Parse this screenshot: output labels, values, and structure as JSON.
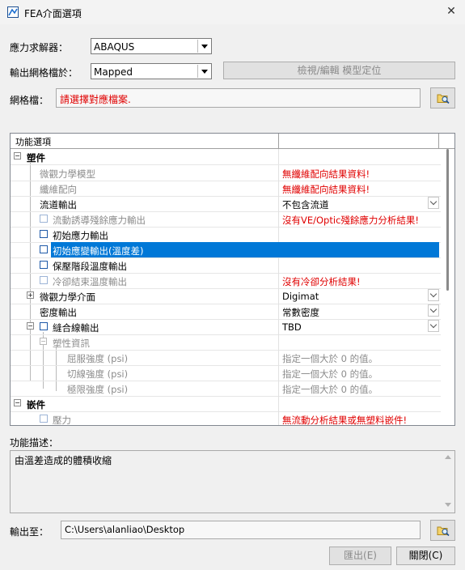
{
  "window": {
    "title": "FEA介面選項",
    "close_glyph": "✕"
  },
  "solver": {
    "label": "應力求解器：",
    "value": "ABAQUS"
  },
  "mesh_output": {
    "label": "輸出網格檔於：",
    "value": "Mapped",
    "button_label": "檢視/編輯 模型定位"
  },
  "mesh_file": {
    "label": "網格檔：",
    "value": "請選擇對應檔案."
  },
  "grid": {
    "header_col1": "功能選項",
    "header_col2": "",
    "rows": [
      {
        "name": "塑件",
        "value": ""
      },
      {
        "name": "微觀力學模型",
        "value": "無纖維配向結果資料!"
      },
      {
        "name": "纖維配向",
        "value": "無纖維配向結果資料!"
      },
      {
        "name": "流道輸出",
        "value": "不包含流道"
      },
      {
        "name": "流動誘導殘餘應力輸出",
        "value": "沒有VE/Optic殘餘應力分析結果!"
      },
      {
        "name": "初始應力輸出",
        "value": ""
      },
      {
        "name": "初始應變輸出(溫度差)",
        "value": ""
      },
      {
        "name": "保壓階段溫度輸出",
        "value": ""
      },
      {
        "name": "冷卻結束溫度輸出",
        "value": "沒有冷卻分析結果!"
      },
      {
        "name": "微觀力學介面",
        "value": "Digimat"
      },
      {
        "name": "密度輸出",
        "value": "常數密度"
      },
      {
        "name": "縫合線輸出",
        "value": "TBD"
      },
      {
        "name": "塑性資訊",
        "value": ""
      },
      {
        "name": "屈服強度 (psi)",
        "value": "指定一個大於 0 的值。"
      },
      {
        "name": "切線強度 (psi)",
        "value": "指定一個大於 0 的值。"
      },
      {
        "name": "極限強度 (psi)",
        "value": "指定一個大於 0 的值。"
      },
      {
        "name": "嵌件",
        "value": ""
      },
      {
        "name": "壓力",
        "value": "無流動分析結果或無塑料嵌件!"
      }
    ]
  },
  "description": {
    "label": "功能描述：",
    "text": "由溫差造成的體積收縮"
  },
  "output_to": {
    "label": "輸出至：",
    "value": "C:\\Users\\alanliao\\Desktop"
  },
  "buttons": {
    "export": "匯出(E)",
    "close": "關閉(C)"
  },
  "icons": {
    "browse": "folder-search-icon",
    "app": "fea-app-icon"
  }
}
